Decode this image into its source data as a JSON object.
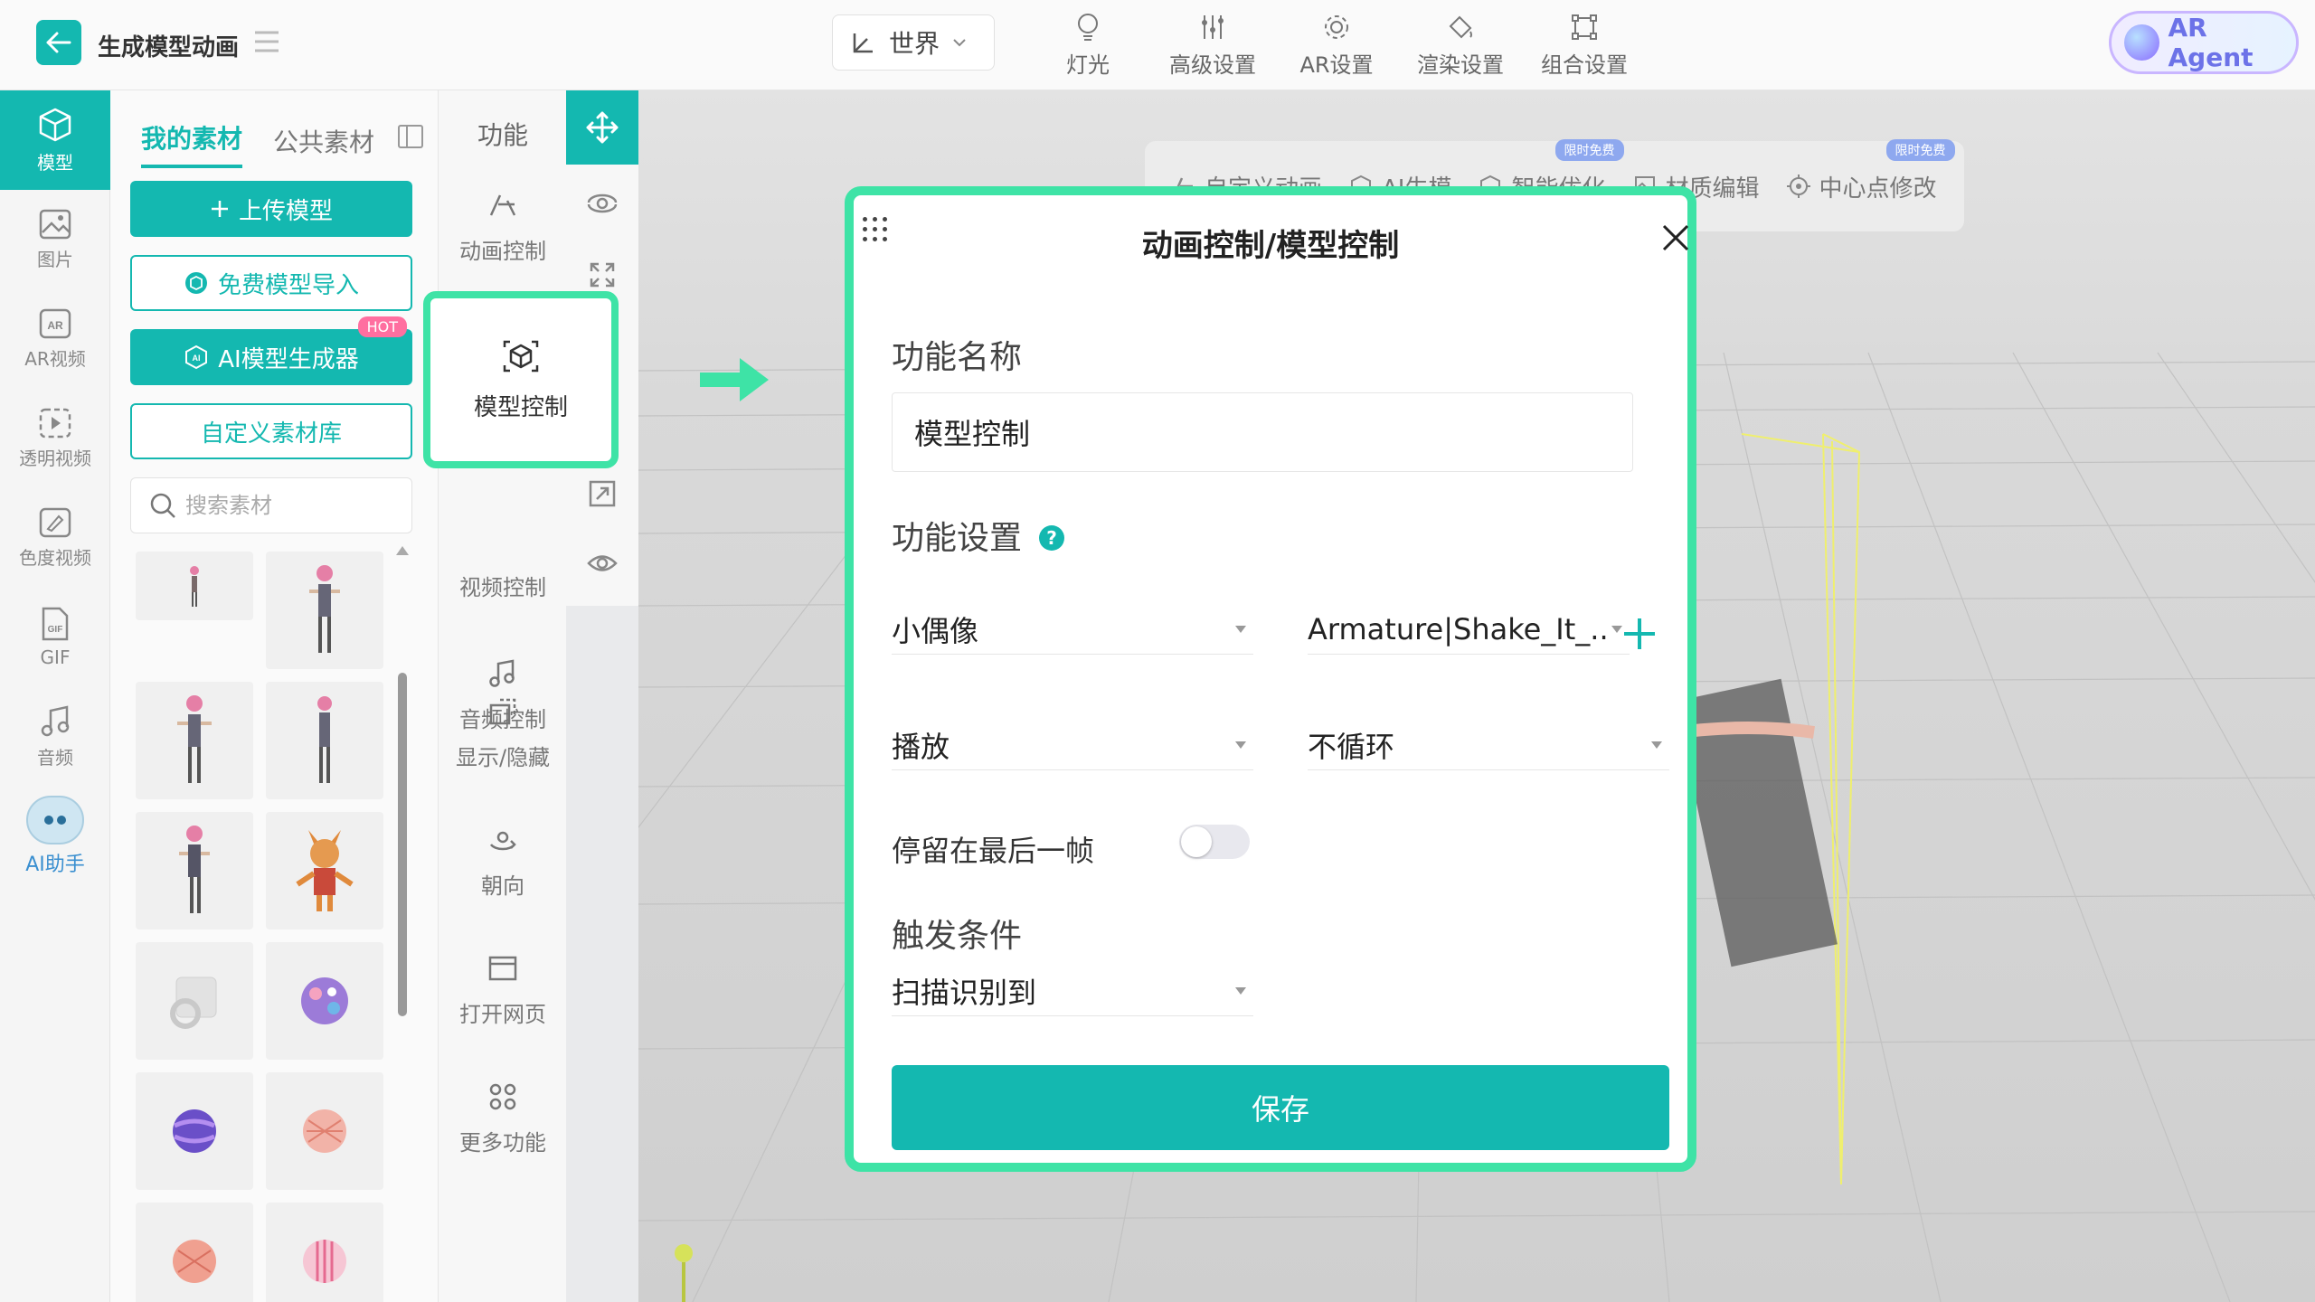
{
  "header": {
    "title": "生成模型动画",
    "world_label": "世界",
    "tools": [
      {
        "label": "灯光",
        "icon": "bulb-icon"
      },
      {
        "label": "高级设置",
        "icon": "sliders-icon"
      },
      {
        "label": "AR设置",
        "icon": "gear-icon"
      },
      {
        "label": "渲染设置",
        "icon": "paint-bucket-icon"
      },
      {
        "label": "组合设置",
        "icon": "group-icon"
      }
    ],
    "agent_label": "AR Agent"
  },
  "rail": {
    "items": [
      {
        "label": "模型",
        "icon": "cube-icon"
      },
      {
        "label": "图片",
        "icon": "image-icon"
      },
      {
        "label": "AR视频",
        "icon": "ar-video-icon"
      },
      {
        "label": "透明视频",
        "icon": "transparent-video-icon"
      },
      {
        "label": "色度视频",
        "icon": "chroma-video-icon"
      },
      {
        "label": "GIF",
        "icon": "gif-icon"
      },
      {
        "label": "音频",
        "icon": "music-icon"
      }
    ],
    "assistant_label": "AI助手"
  },
  "assets": {
    "tab_mine": "我的素材",
    "tab_public": "公共素材",
    "upload_label": "上传模型",
    "import_label": "免费模型导入",
    "ai_gen_label": "AI模型生成器",
    "hot_badge": "HOT",
    "custom_lib_label": "自定义素材库",
    "search_placeholder": "搜索素材"
  },
  "functions": {
    "header": "功能",
    "items": [
      {
        "label": "动画控制",
        "icon": "animation-icon"
      },
      {
        "label": "模型控制",
        "icon": "model-control-icon"
      },
      {
        "label": "视频控制",
        "icon": "video-icon"
      },
      {
        "label": "音频控制",
        "icon": "music-note-icon"
      },
      {
        "label": "显示/隐藏",
        "icon": "visibility-toggle-icon"
      },
      {
        "label": "朝向",
        "icon": "orientation-icon"
      },
      {
        "label": "打开网页",
        "icon": "browser-icon"
      },
      {
        "label": "更多功能",
        "icon": "more-icon"
      }
    ]
  },
  "viewport_toolbar": {
    "items": [
      {
        "label": "自定义动画"
      },
      {
        "label": "AI生模"
      },
      {
        "label": "智能优化"
      },
      {
        "label": "材质编辑"
      },
      {
        "label": "中心点修改"
      }
    ],
    "badge_label": "限时免费"
  },
  "dialog": {
    "title": "动画控制/模型控制",
    "name_section": "功能名称",
    "name_value": "模型控制",
    "settings_section": "功能设置",
    "help_glyph": "?",
    "target_value": "小偶像",
    "animation_value": "Armature|Shake_It_...",
    "action_value": "播放",
    "loop_value": "不循环",
    "stop_last_frame_label": "停留在最后一帧",
    "stop_last_frame_on": false,
    "trigger_section": "触发条件",
    "trigger_value": "扫描识别到",
    "save_label": "保存"
  },
  "colors": {
    "accent": "#14b8b0",
    "highlight": "#3ee3a6"
  }
}
